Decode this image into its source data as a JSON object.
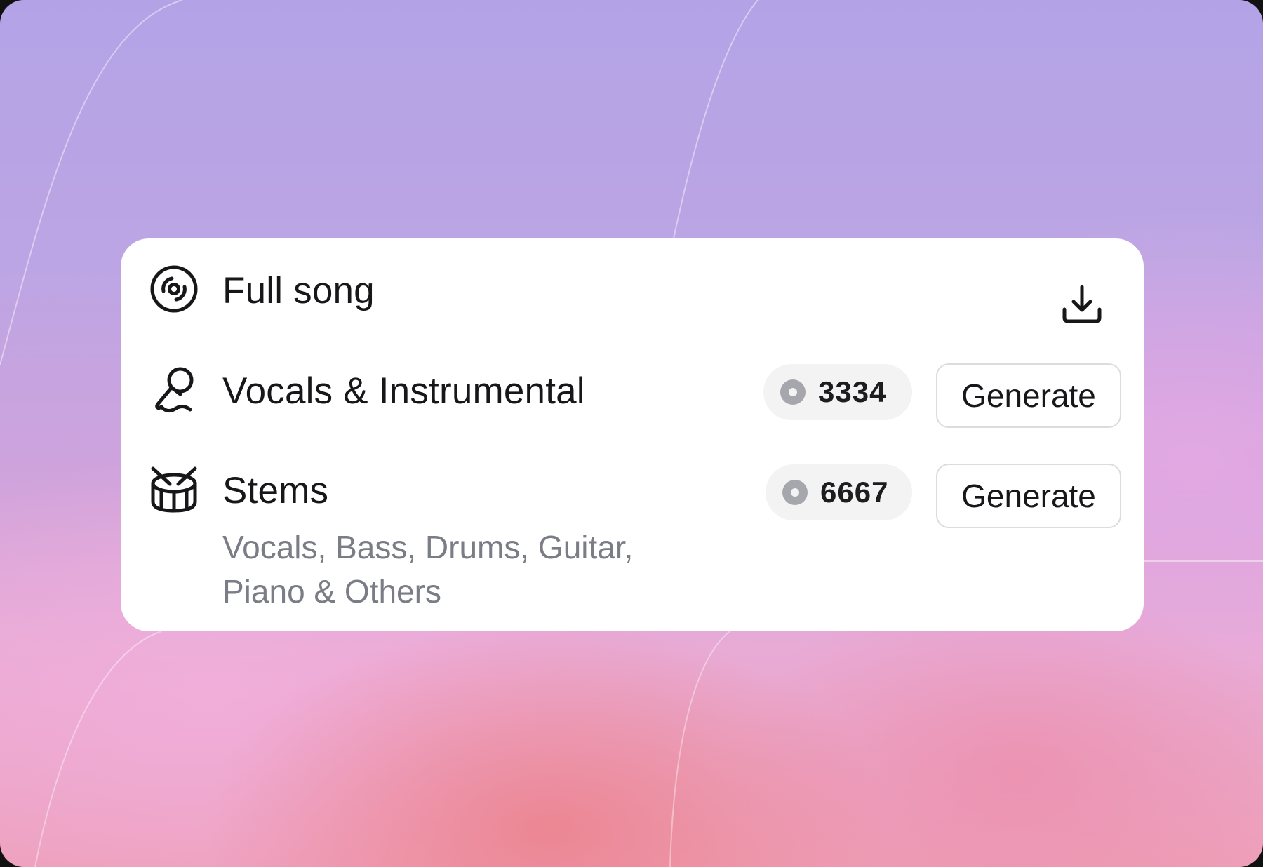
{
  "options": {
    "full_song": {
      "title": "Full song",
      "icon": "disc-icon",
      "action_icon": "download-icon"
    },
    "vocals_instrumental": {
      "title": "Vocals & Instrumental",
      "icon": "microphone-icon",
      "credits": "3334",
      "button_label": "Generate"
    },
    "stems": {
      "title": "Stems",
      "icon": "drum-icon",
      "subtitle_line1": "Vocals, Bass, Drums, Guitar,",
      "subtitle_line2": "Piano & Others",
      "credits": "6667",
      "button_label": "Generate"
    }
  },
  "colors": {
    "card_background": "#ffffff",
    "text_primary": "#17171a",
    "text_secondary": "#7b7d86",
    "pill_background": "#f3f3f4",
    "credit_icon": "#a6a7ad",
    "button_border": "#dcdce0"
  }
}
